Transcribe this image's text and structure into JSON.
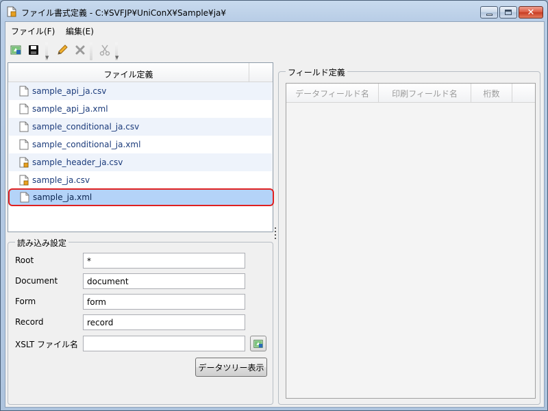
{
  "window": {
    "title": "ファイル書式定義 - C:¥SVFJP¥UniConX¥Sample¥ja¥"
  },
  "menu": [
    {
      "label": "ファイル(F)"
    },
    {
      "label": "編集(E)"
    }
  ],
  "toolbar": {
    "icons": [
      "open-icon",
      "save-icon",
      "edit-icon",
      "delete-icon",
      "cut-icon"
    ]
  },
  "file_list": {
    "header": "ファイル定義",
    "items": [
      {
        "label": "sample_api_ja.csv",
        "icon": "document-icon"
      },
      {
        "label": "sample_api_ja.xml",
        "icon": "document-icon"
      },
      {
        "label": "sample_conditional_ja.csv",
        "icon": "document-icon"
      },
      {
        "label": "sample_conditional_ja.xml",
        "icon": "document-icon"
      },
      {
        "label": "sample_header_ja.csv",
        "icon": "document-lock-icon"
      },
      {
        "label": "sample_ja.csv",
        "icon": "document-lock-icon"
      },
      {
        "label": "sample_ja.xml",
        "icon": "document-icon",
        "selected": true
      }
    ]
  },
  "read_settings": {
    "title": "読み込み設定",
    "fields": [
      {
        "label": "Root",
        "value": "*"
      },
      {
        "label": "Document",
        "value": "document"
      },
      {
        "label": "Form",
        "value": "form"
      },
      {
        "label": "Record",
        "value": "record"
      },
      {
        "label": "XSLT ファイル名",
        "value": ""
      }
    ],
    "tree_button": "データツリー表示"
  },
  "field_def": {
    "title": "フィールド定義",
    "columns": [
      "データフィールド名",
      "印刷フィールド名",
      "桁数"
    ]
  }
}
